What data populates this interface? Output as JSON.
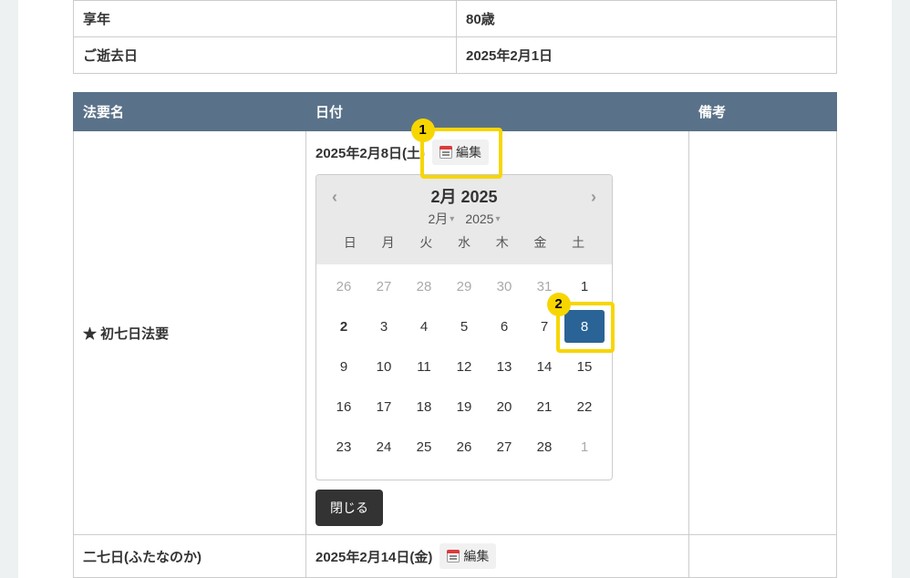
{
  "info": {
    "age_label": "享年",
    "age_value": "80歳",
    "death_label": "ご逝去日",
    "death_value": "2025年2月1日"
  },
  "schedule": {
    "headers": {
      "name": "法要名",
      "date": "日付",
      "notes": "備考"
    },
    "row1": {
      "name": "★ 初七日法要",
      "date": "2025年2月8日(土)"
    },
    "row2": {
      "name": "二七日(ふたなのか)",
      "date": "2025年2月14日(金)"
    }
  },
  "buttons": {
    "edit": "編集",
    "close": "閉じる"
  },
  "dp": {
    "title": "2月 2025",
    "month_sel": "2月",
    "year_sel": "2025",
    "dow": {
      "d0": "日",
      "d1": "月",
      "d2": "火",
      "d3": "水",
      "d4": "木",
      "d5": "金",
      "d6": "土"
    },
    "days": {
      "w0d0": "26",
      "w0d1": "27",
      "w0d2": "28",
      "w0d3": "29",
      "w0d4": "30",
      "w0d5": "31",
      "w0d6": "1",
      "w1d0": "2",
      "w1d1": "3",
      "w1d2": "4",
      "w1d3": "5",
      "w1d4": "6",
      "w1d5": "7",
      "w1d6": "8",
      "w2d0": "9",
      "w2d1": "10",
      "w2d2": "11",
      "w2d3": "12",
      "w2d4": "13",
      "w2d5": "14",
      "w2d6": "15",
      "w3d0": "16",
      "w3d1": "17",
      "w3d2": "18",
      "w3d3": "19",
      "w3d4": "20",
      "w3d5": "21",
      "w3d6": "22",
      "w4d0": "23",
      "w4d1": "24",
      "w4d2": "25",
      "w4d3": "26",
      "w4d4": "27",
      "w4d5": "28",
      "w4d6": "1"
    }
  },
  "annot": {
    "n1": "1",
    "n2": "2"
  }
}
